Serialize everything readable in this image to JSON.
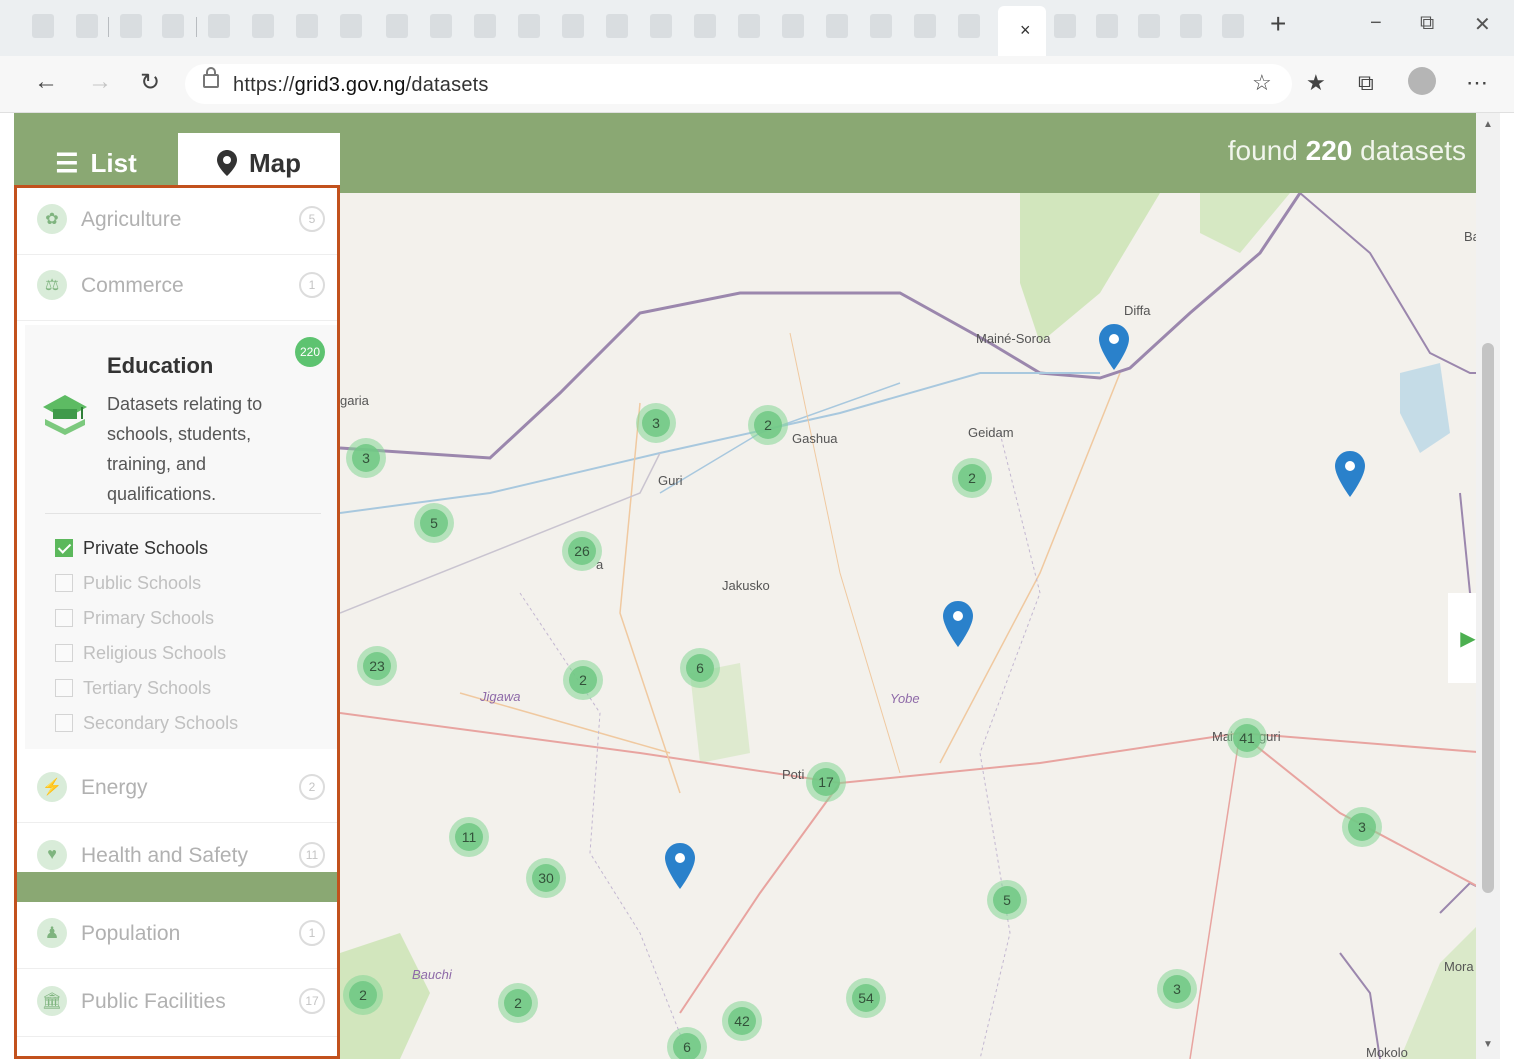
{
  "browser": {
    "active_tab_close": "×",
    "new_tab": "+",
    "window_controls": {
      "minimize": "−",
      "restore": "⧉",
      "close": "✕"
    },
    "url_prefix": "https://",
    "url_host": "grid3.gov.ng",
    "url_path": "/datasets",
    "icons": [
      "back-arrow-icon",
      "forward-arrow-icon",
      "refresh-icon",
      "lock-icon",
      "read-aloud-icon",
      "favorites-icon",
      "collections-icon",
      "profile-avatar",
      "more-icon"
    ]
  },
  "header": {
    "list_label": "List",
    "map_label": "Map",
    "found_prefix": "found",
    "found_count": "220",
    "found_suffix": "datasets"
  },
  "sidebar": {
    "categories_top": [
      {
        "label": "Agriculture",
        "count": "5",
        "icon": "agriculture-icon"
      },
      {
        "label": "Commerce",
        "count": "1",
        "icon": "commerce-icon"
      }
    ],
    "education": {
      "title": "Education",
      "count": "220",
      "description": "Datasets relating to schools, students, training, and qualifications.",
      "options": [
        {
          "label": "Private Schools",
          "checked": true
        },
        {
          "label": "Public Schools",
          "checked": false
        },
        {
          "label": "Primary Schools",
          "checked": false
        },
        {
          "label": "Religious Schools",
          "checked": false
        },
        {
          "label": "Tertiary Schools",
          "checked": false
        },
        {
          "label": "Secondary Schools",
          "checked": false
        }
      ]
    },
    "categories_bottom": [
      {
        "label": "Energy",
        "count": "2",
        "icon": "energy-icon"
      },
      {
        "label": "Health and Safety",
        "count": "11",
        "icon": "health-icon"
      },
      {
        "label": "Population",
        "count": "1",
        "icon": "population-icon"
      },
      {
        "label": "Public Facilities",
        "count": "17",
        "icon": "public-facilities-icon"
      }
    ]
  },
  "map": {
    "clusters": [
      "3",
      "2",
      "3",
      "2",
      "5",
      "26",
      "23",
      "2",
      "6",
      "17",
      "41",
      "11",
      "30",
      "5",
      "3",
      "2",
      "2",
      "42",
      "54",
      "6",
      "3"
    ],
    "labels": {
      "maine_soroa": "Mainé-Soroa",
      "diffa": "Diffa",
      "gashua": "Gashua",
      "geidam": "Geidam",
      "guri": "Guri",
      "jakusko": "Jakusko",
      "jigawa": "Jigawa",
      "yobe": "Yobe",
      "potiskum": "Poti",
      "maiduguri_a": "Mai",
      "maiduguri_b": "guri",
      "bauchi": "Bauchi",
      "mora": "Mora",
      "mokolo": "Mokolo",
      "bag": "Bag",
      "garia": "garia",
      "hadejia": "a"
    }
  }
}
